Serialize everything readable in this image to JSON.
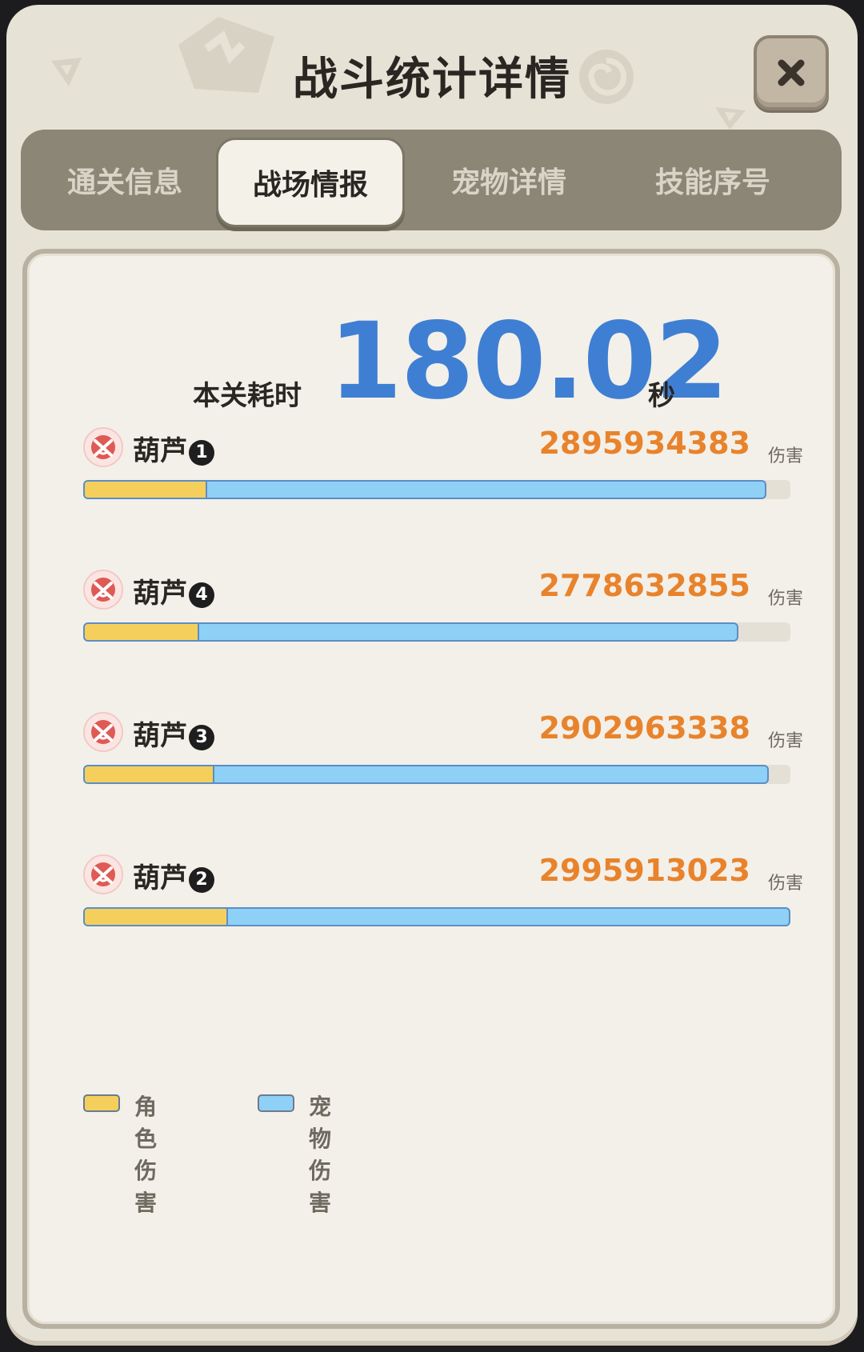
{
  "title": "战斗统计详情",
  "tabs": [
    {
      "label": "通关信息",
      "active": false
    },
    {
      "label": "战场情报",
      "active": true
    },
    {
      "label": "宠物详情",
      "active": false
    },
    {
      "label": "技能序号",
      "active": false
    }
  ],
  "stage": {
    "time_label": "本关耗时",
    "time_value": "180.02",
    "time_unit": "秒"
  },
  "damage_unit": "伤害",
  "players": [
    {
      "name": "葫芦",
      "badge": "1",
      "damage": "2895934383",
      "total_fraction": 0.966,
      "character_fraction": 0.173
    },
    {
      "name": "葫芦",
      "badge": "4",
      "damage": "2778632855",
      "total_fraction": 0.927,
      "character_fraction": 0.162
    },
    {
      "name": "葫芦",
      "badge": "3",
      "damage": "2902963338",
      "total_fraction": 0.969,
      "character_fraction": 0.183
    },
    {
      "name": "葫芦",
      "badge": "2",
      "damage": "2995913023",
      "total_fraction": 1.0,
      "character_fraction": 0.202
    }
  ],
  "legend": {
    "character": "角色伤害",
    "pet": "宠物伤害"
  },
  "colors": {
    "character_damage": "#f5cf5c",
    "pet_damage": "#8fd0f6",
    "damage_text": "#e8832c",
    "time_text": "#3f7fd3"
  }
}
